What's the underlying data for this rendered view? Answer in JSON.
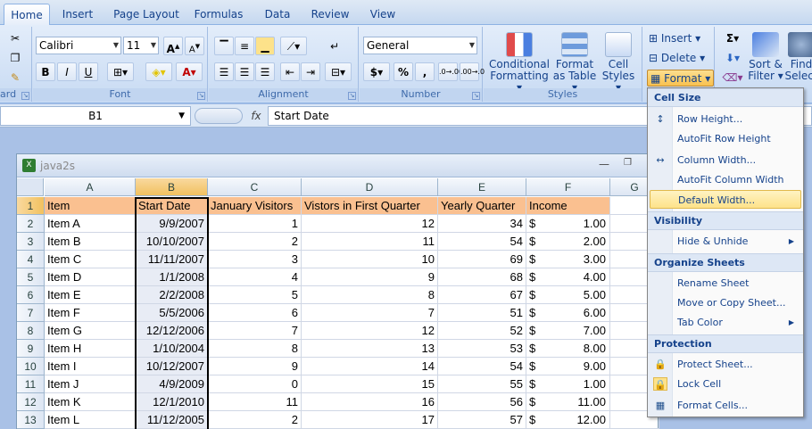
{
  "tabs": [
    "Home",
    "Insert",
    "Page Layout",
    "Formulas",
    "Data",
    "Review",
    "View"
  ],
  "clipboard": {
    "label": "ard"
  },
  "font": {
    "name": "Calibri",
    "size": "11",
    "label": "Font",
    "bold": "B",
    "italic": "I",
    "underline": "U",
    "grow": "A",
    "shrink": "A",
    "font_color_glyph": "A"
  },
  "alignment": {
    "label": "Alignment"
  },
  "number": {
    "format": "General",
    "label": "Number",
    "currency": "$",
    "percent": "%",
    "comma": ",",
    "inc_dec": ".0→.00",
    "dec_dec": ".00→.0"
  },
  "styles": {
    "label": "Styles",
    "conditional": [
      "Conditional",
      "Formatting ▾"
    ],
    "format_table": [
      "Format",
      "as Table ▾"
    ],
    "cell_styles": [
      "Cell",
      "Styles ▾"
    ]
  },
  "cells_group": {
    "insert": "Insert ▾",
    "delete": "Delete ▾",
    "format": "Format ▾"
  },
  "editing": {
    "sum": "Σ",
    "sort": [
      "Sort &",
      "Filter ▾"
    ],
    "find": [
      "Find",
      "Select"
    ]
  },
  "formula_bar": {
    "name_box": "B1",
    "fx": "fx",
    "formula": "Start Date"
  },
  "workbook": {
    "title": "java2s"
  },
  "columns": [
    "A",
    "B",
    "C",
    "D",
    "E",
    "F",
    "G"
  ],
  "row_numbers": [
    "1",
    "2",
    "3",
    "4",
    "5",
    "6",
    "7",
    "8",
    "9",
    "10",
    "11",
    "12",
    "13"
  ],
  "headers": [
    "Item",
    "Start Date",
    "January Visitors",
    "Vistors in First Quarter",
    "Yearly Quarter",
    "Income"
  ],
  "rows": [
    [
      "Item A",
      "9/9/2007",
      "1",
      "12",
      "34",
      "$",
      "1.00"
    ],
    [
      "Item B",
      "10/10/2007",
      "2",
      "11",
      "54",
      "$",
      "2.00"
    ],
    [
      "Item C",
      "11/11/2007",
      "3",
      "10",
      "69",
      "$",
      "3.00"
    ],
    [
      "Item D",
      "1/1/2008",
      "4",
      "9",
      "68",
      "$",
      "4.00"
    ],
    [
      "Item E",
      "2/2/2008",
      "5",
      "8",
      "67",
      "$",
      "5.00"
    ],
    [
      "Item F",
      "5/5/2006",
      "6",
      "7",
      "51",
      "$",
      "6.00"
    ],
    [
      "Item G",
      "12/12/2006",
      "7",
      "12",
      "52",
      "$",
      "7.00"
    ],
    [
      "Item H",
      "1/10/2004",
      "8",
      "13",
      "53",
      "$",
      "8.00"
    ],
    [
      "Item I",
      "10/12/2007",
      "9",
      "14",
      "54",
      "$",
      "9.00"
    ],
    [
      "Item J",
      "4/9/2009",
      "0",
      "15",
      "55",
      "$",
      "1.00"
    ],
    [
      "Item K",
      "12/1/2010",
      "11",
      "16",
      "56",
      "$",
      "11.00"
    ],
    [
      "Item L",
      "11/12/2005",
      "2",
      "17",
      "57",
      "$",
      "12.00"
    ]
  ],
  "menu": {
    "sections": {
      "cell_size": "Cell Size",
      "visibility": "Visibility",
      "organize": "Organize Sheets",
      "protection": "Protection"
    },
    "items": {
      "row_height": "Row Height...",
      "autofit_row": "AutoFit Row Height",
      "column_width": "Column Width...",
      "autofit_col": "AutoFit Column Width",
      "default_width": "Default Width...",
      "hide_unhide": "Hide & Unhide",
      "rename": "Rename Sheet",
      "move_copy": "Move or Copy Sheet...",
      "tab_color": "Tab Color",
      "protect": "Protect Sheet...",
      "lock": "Lock Cell",
      "format_cells": "Format Cells..."
    }
  },
  "colors": {
    "header_fill": "#fac090",
    "highlight": "#fde28a",
    "accent": "#15428b"
  }
}
